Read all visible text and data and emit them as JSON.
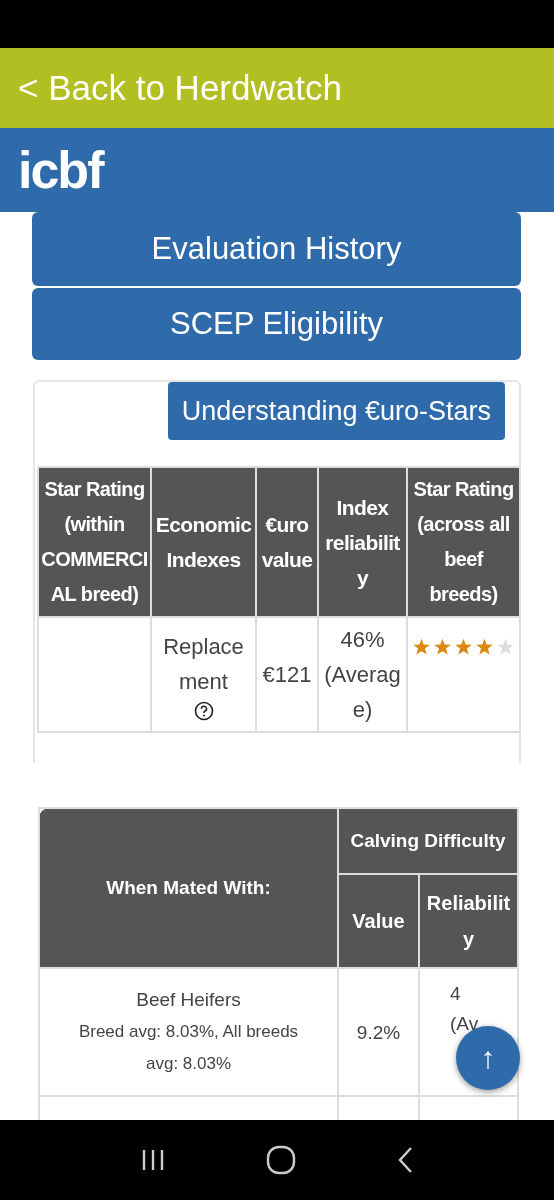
{
  "top_bar": {
    "back_link": "< Back to Herdwatch"
  },
  "header": {
    "logo": "icbf"
  },
  "nav_buttons": [
    "Evaluation History",
    "SCEP Eligibility"
  ],
  "eurostars": {
    "button": "Understanding €uro-Stars",
    "columns": [
      "Star Rating (within COMMERCIAL breed)",
      "Economic Indexes",
      "€uro value",
      "Index reliability",
      "Star Rating (across all beef breeds)"
    ],
    "rows": [
      {
        "index": "Replacement",
        "has_help": true,
        "value": "€121",
        "reliability": "46% (Average)",
        "stars": 4
      }
    ]
  },
  "calving": {
    "mated_header": "When Mated With:",
    "group_header": "Calving Difficulty",
    "columns": [
      "Value",
      "Reliability"
    ],
    "rows": [
      {
        "name": "Beef Heifers",
        "note": "Breed avg: 8.03%, All breeds avg: 8.03%",
        "value": "9.2%",
        "reliability": [
          "4",
          "(Av"
        ]
      }
    ]
  },
  "scroll_top": "↑"
}
